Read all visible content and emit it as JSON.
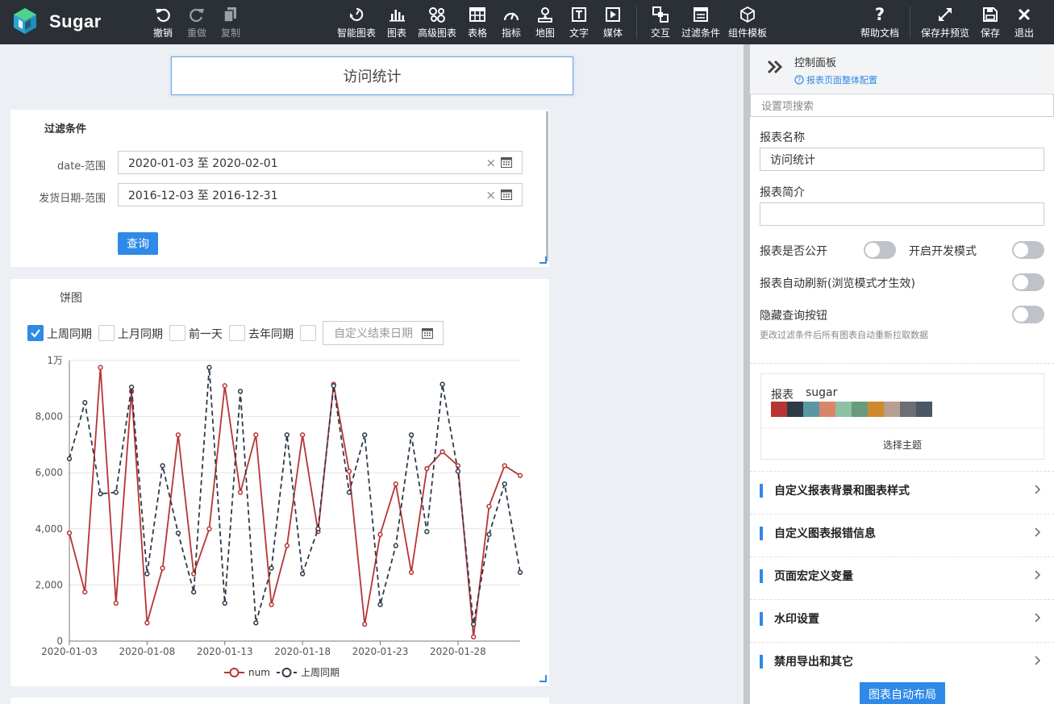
{
  "app": {
    "name": "Sugar"
  },
  "toolbar": {
    "undo": "撤销",
    "redo": "重做",
    "copy": "复制",
    "smart_chart": "智能图表",
    "chart": "图表",
    "advanced_chart": "高级图表",
    "table": "表格",
    "indicator": "指标",
    "map": "地图",
    "text": "文字",
    "media": "媒体",
    "interaction": "交互",
    "filter": "过滤条件",
    "component_template": "组件模板",
    "help": "帮助文档",
    "save_preview": "保存并预览",
    "save": "保存",
    "exit": "退出"
  },
  "report": {
    "title": "访问统计"
  },
  "filter": {
    "title": "过滤条件",
    "date_label": "date-范围",
    "date_value": "2020-01-03 至 2020-02-01",
    "ship_label": "发货日期-范围",
    "ship_value": "2016-12-03 至 2016-12-31",
    "query_button": "查询"
  },
  "chart_card": {
    "title": "饼图",
    "compare": [
      {
        "label": "上周同期",
        "checked": true
      },
      {
        "label": "上月同期",
        "checked": false
      },
      {
        "label": "前一天",
        "checked": false
      },
      {
        "label": "去年同期",
        "checked": false
      }
    ],
    "end_date_placeholder": "自定义结束日期"
  },
  "chart_data": {
    "type": "line",
    "x": [
      "2020-01-03",
      "2020-01-04",
      "2020-01-05",
      "2020-01-06",
      "2020-01-07",
      "2020-01-08",
      "2020-01-09",
      "2020-01-10",
      "2020-01-11",
      "2020-01-12",
      "2020-01-13",
      "2020-01-14",
      "2020-01-15",
      "2020-01-16",
      "2020-01-17",
      "2020-01-18",
      "2020-01-19",
      "2020-01-20",
      "2020-01-21",
      "2020-01-22",
      "2020-01-23",
      "2020-01-24",
      "2020-01-25",
      "2020-01-26",
      "2020-01-27",
      "2020-01-28",
      "2020-01-29",
      "2020-01-30",
      "2020-01-31",
      "2020-02-01"
    ],
    "x_tick_labels": [
      "2020-01-03",
      "2020-01-08",
      "2020-01-13",
      "2020-01-18",
      "2020-01-23",
      "2020-01-28"
    ],
    "y_tick_labels": [
      "0",
      "2,000",
      "4,000",
      "6,000",
      "8,000",
      "1万"
    ],
    "ylim": [
      0,
      10000
    ],
    "grid": true,
    "legend_position": "bottom",
    "series": [
      {
        "name": "num",
        "color": "#b83434",
        "dashed": false,
        "values": [
          3850,
          1750,
          9750,
          1350,
          8900,
          650,
          2600,
          7350,
          2400,
          4000,
          9100,
          5300,
          7350,
          1300,
          3400,
          7350,
          3900,
          9150,
          6050,
          600,
          3800,
          5600,
          2450,
          6150,
          6750,
          6250,
          150,
          4800,
          6250,
          5900
        ]
      },
      {
        "name": "上周同期",
        "color": "#2d3a48",
        "dashed": true,
        "values": [
          6500,
          8500,
          5250,
          5300,
          9050,
          2400,
          6250,
          3850,
          1750,
          9750,
          1350,
          8900,
          650,
          2600,
          7350,
          2400,
          4000,
          9100,
          5300,
          7350,
          1300,
          3400,
          7350,
          3900,
          9150,
          6050,
          600,
          3800,
          5600,
          2450
        ]
      }
    ]
  },
  "panel": {
    "title": "控制面板",
    "link": "报表页面整体配置",
    "search_placeholder": "设置项搜索",
    "name_label": "报表名称",
    "name_value": "访问统计",
    "desc_label": "报表简介",
    "desc_value": "",
    "public_label": "报表是否公开",
    "dev_label": "开启开发模式",
    "refresh_label": "报表自动刷新(浏览模式才生效)",
    "hide_query_label": "隐藏查询按钮",
    "hint": "更改过滤条件后所有图表自动重新拉取数据",
    "theme_label": "报表",
    "theme_name": "sugar",
    "theme_colors": [
      "#b83434",
      "#2d3a48",
      "#5b97a3",
      "#d98668",
      "#8cc1a3",
      "#6a9a7e",
      "#cf8a2e",
      "#b99e92",
      "#6b6e75",
      "#4a5866"
    ],
    "theme_button": "选择主题",
    "sections": [
      "自定义报表背景和图表样式",
      "自定义图表报错信息",
      "页面宏定义变量",
      "水印设置",
      "禁用导出和其它"
    ],
    "auto_layout": "图表自动布局"
  }
}
